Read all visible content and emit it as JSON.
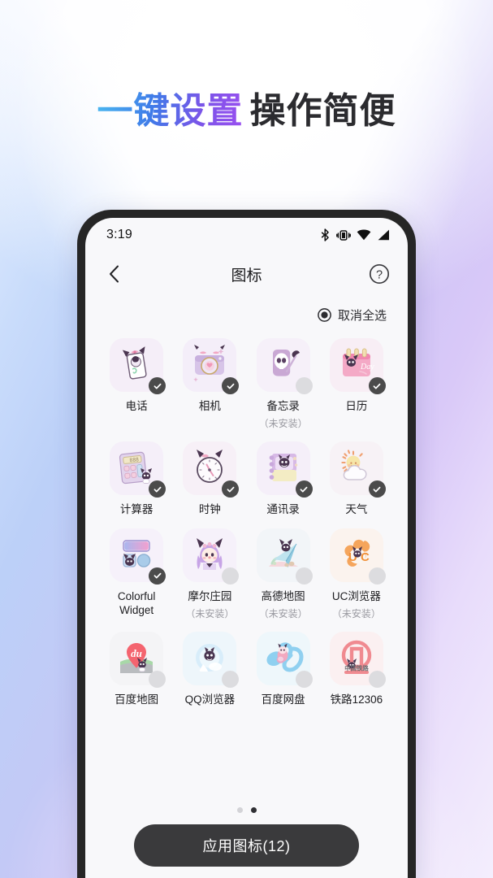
{
  "promo": {
    "headline_gradient": "一键设置",
    "headline_dark": "操作简便",
    "accent_start": "#4ab8f0",
    "accent_end": "#9b4ff0"
  },
  "phone": {
    "statusbar": {
      "time": "3:19",
      "icons": [
        "bluetooth-icon",
        "vibrate-icon",
        "wifi-icon",
        "signal-icon"
      ]
    },
    "appbar": {
      "back_icon": "chevron-left-icon",
      "title": "图标",
      "help_icon": "help-circle-icon"
    },
    "selectall": {
      "icon": "radio-selected-icon",
      "label": "取消全选"
    },
    "grid": {
      "not_installed_text": "（未安装）",
      "rows": [
        [
          {
            "label": "电话",
            "selected": true,
            "installed": true,
            "tile_bg": "#f5eef8",
            "art": "phone-card-art"
          },
          {
            "label": "相机",
            "selected": true,
            "installed": true,
            "tile_bg": "#f4eef9",
            "art": "camera-art"
          },
          {
            "label": "备忘录",
            "selected": false,
            "installed": false,
            "tile_bg": "#f6f0f9",
            "art": "memo-skull-art"
          },
          {
            "label": "日历",
            "selected": true,
            "installed": true,
            "tile_bg": "#f8eef5",
            "art": "calendar-art"
          }
        ],
        [
          {
            "label": "计算器",
            "selected": true,
            "installed": true,
            "tile_bg": "#f5eff9",
            "art": "calculator-art"
          },
          {
            "label": "时钟",
            "selected": true,
            "installed": true,
            "tile_bg": "#f7f0f7",
            "art": "clock-art"
          },
          {
            "label": "通讯录",
            "selected": true,
            "installed": true,
            "tile_bg": "#f5eff9",
            "art": "contacts-art"
          },
          {
            "label": "天气",
            "selected": true,
            "installed": true,
            "tile_bg": "#f7f2f6",
            "art": "weather-art"
          }
        ],
        [
          {
            "label": "Colorful Widget",
            "selected": true,
            "installed": true,
            "tile_bg": "#f6f1fa",
            "art": "colorful-widget-art"
          },
          {
            "label": "摩尔庄园",
            "selected": false,
            "installed": false,
            "tile_bg": "#f6f1fa",
            "art": "molehill-girl-art"
          },
          {
            "label": "高德地图",
            "selected": false,
            "installed": false,
            "tile_bg": "#f2f5f8",
            "art": "amap-art"
          },
          {
            "label": "UC浏览器",
            "selected": false,
            "installed": false,
            "tile_bg": "#fbf3ee",
            "art": "uc-browser-art"
          }
        ],
        [
          {
            "label": "百度地图",
            "selected": false,
            "installed": true,
            "tile_bg": "#f4f4f6",
            "art": "baidu-map-art"
          },
          {
            "label": "QQ浏览器",
            "selected": false,
            "installed": true,
            "tile_bg": "#eef6fb",
            "art": "qq-browser-art"
          },
          {
            "label": "百度网盘",
            "selected": false,
            "installed": true,
            "tile_bg": "#eef7fb",
            "art": "baidu-netdisk-art"
          },
          {
            "label": "铁路12306",
            "selected": false,
            "installed": true,
            "tile_bg": "#fbf0f1",
            "art": "railway-12306-art"
          }
        ]
      ]
    },
    "pager": {
      "count": 2,
      "active_index": 1
    },
    "cta": {
      "label": "应用图标(12)"
    }
  }
}
